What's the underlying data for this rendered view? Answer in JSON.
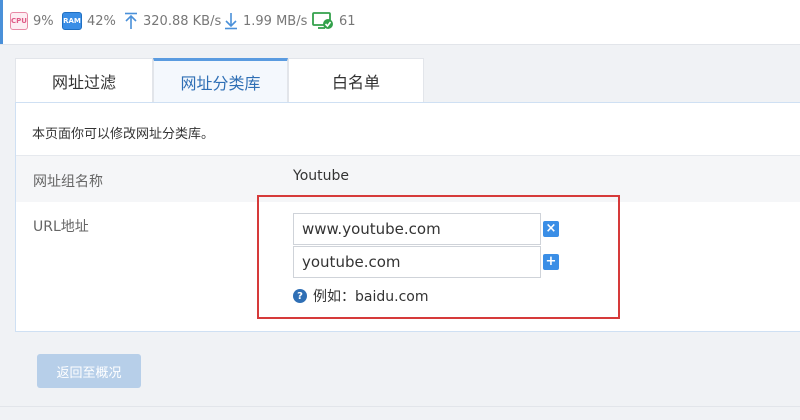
{
  "status": {
    "cpu_icon": "CPU",
    "cpu": "9%",
    "ram_icon": "RAM",
    "ram": "42%",
    "upload": "320.88 KB/s",
    "download": "1.99 MB/s",
    "devices": "61",
    "icons": [
      "cpu-icon",
      "ram-icon",
      "upload-arrow-icon",
      "download-arrow-icon",
      "monitor-check-icon"
    ]
  },
  "tabs": [
    {
      "label": "网址过滤",
      "active": false
    },
    {
      "label": "网址分类库",
      "active": true
    },
    {
      "label": "白名单",
      "active": false
    }
  ],
  "panel": {
    "description": "本页面你可以修改网址分类库。",
    "group_name_label": "网址组名称",
    "group_name_value": "Youtube",
    "url_label": "URL地址",
    "urls": [
      "www.youtube.com",
      "youtube.com"
    ],
    "remove_glyph": "×",
    "add_glyph": "+",
    "hint": "例如：baidu.com"
  },
  "footer": {
    "back_label": "返回至概况"
  },
  "colors": {
    "accent": "#3a8ee6",
    "highlight": "#d63a3a",
    "back_button": "#b7cfe9"
  }
}
